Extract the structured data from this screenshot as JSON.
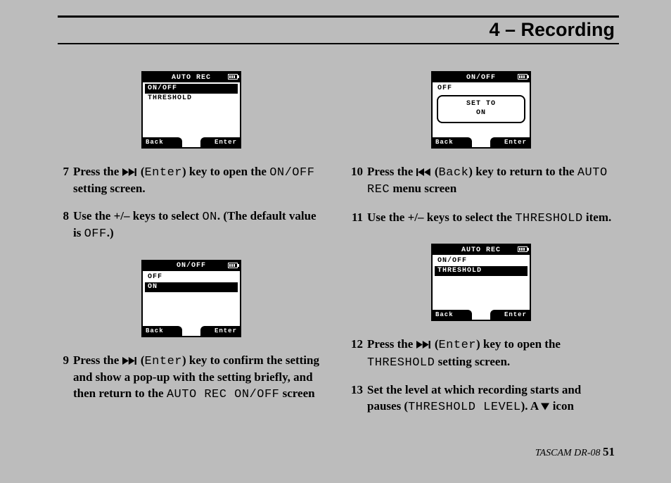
{
  "header": {
    "title": "4 – Recording"
  },
  "lcd_common": {
    "back": "Back",
    "enter": "Enter"
  },
  "lcd1": {
    "title": "AUTO REC",
    "row1": "ON/OFF",
    "row2": "THRESHOLD"
  },
  "lcd2": {
    "title": "ON/OFF",
    "row1": "OFF",
    "row2": "ON"
  },
  "lcd3": {
    "title": "ON/OFF",
    "row1": "OFF",
    "popup_l1": "SET TO",
    "popup_l2": "ON"
  },
  "lcd4": {
    "title": "AUTO REC",
    "row1": "ON/OFF",
    "row2": "THRESHOLD"
  },
  "steps": {
    "s7": {
      "num": "7",
      "a": "Press the ",
      "b": " (",
      "enter": "Enter",
      "c": ") key to open the ",
      "onoff": "ON/OFF",
      "d": " setting screen."
    },
    "s8": {
      "num": "8",
      "a": "Use the +/– keys to select ",
      "on": "ON",
      "b": ". (The default value is ",
      "off": "OFF",
      "c": ".)"
    },
    "s9": {
      "num": "9",
      "a": "Press the ",
      "b": " (",
      "enter": "Enter",
      "c": ") key to confirm the setting and show a pop-up with the setting briefly, and then return to the ",
      "autorec": "AUTO REC ON/OFF",
      "d": " screen"
    },
    "s10": {
      "num": "10",
      "a": "Press the ",
      "b": " (",
      "back": "Back",
      "c": ") key to return to the ",
      "autorec": "AUTO REC",
      "d": " menu screen"
    },
    "s11": {
      "num": "11",
      "a": "Use the +/– keys to select the ",
      "thr": "THRESHOLD",
      "b": " item."
    },
    "s12": {
      "num": "12",
      "a": "Press the ",
      "b": " (",
      "enter": "Enter",
      "c": ") key to open the ",
      "thr": "THRESHOLD",
      "d": " setting screen."
    },
    "s13": {
      "num": "13",
      "a": "Set the level at which recording starts and pauses (",
      "thr": "THRESHOLD LEVEL",
      "b": "). A ",
      "c": " icon"
    }
  },
  "footer": {
    "model": "TASCAM  DR-08 ",
    "page": "51"
  }
}
